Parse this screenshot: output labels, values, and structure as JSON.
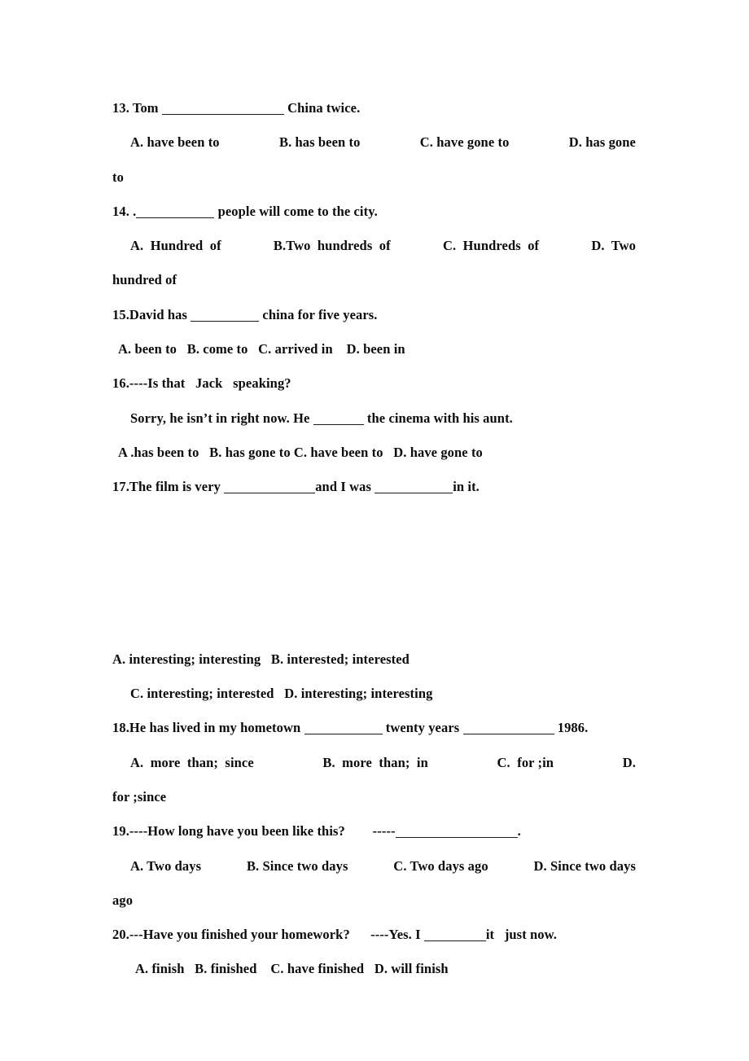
{
  "document": {
    "type": "english-grammar-multiple-choice-worksheet",
    "page_background": "#ffffff",
    "text_color": "#0b0b0b"
  },
  "questions": [
    {
      "number": "13.",
      "stem_before": "13. Tom ",
      "stem_after": " China twice.",
      "options_line": {
        "a": "A. have been to",
        "b": "B. has been to",
        "c": "C. have gone to",
        "d": "D. has gone"
      },
      "wrap": "to"
    },
    {
      "number": "14.",
      "stem_before": "14. .",
      "stem_after": " people will come to the city.",
      "options_line": {
        "a": "A.  Hundred  of",
        "b": "B.Two  hundreds  of",
        "c": "C.  Hundreds  of",
        "d": "D.  Two"
      },
      "wrap": "hundred of"
    },
    {
      "number": "15.",
      "stem_before": "15.David has ",
      "stem_after": " china for five years.",
      "options_line_text": "A. been to   B. come to   C. arrived in    D. been in"
    },
    {
      "number": "16.",
      "stem_text": "16.----Is that   Jack   speaking?",
      "dialogue_before": "Sorry, he isn’t in right now. He ",
      "dialogue_after": " the cinema with his aunt.",
      "options_line_text": "A .has been to   B. has gone to C. have been to   D. have gone to"
    },
    {
      "number": "17.",
      "stem_part1": "17.The film is very ",
      "stem_part2": "and I was ",
      "stem_part3": "in it.",
      "options_line_1": "A. interesting; interesting   B. interested; interested",
      "options_line_2": "C. interesting; interested   D. interesting; interesting"
    },
    {
      "number": "18.",
      "stem_part1": "18.He has lived in my hometown ",
      "stem_part2": " twenty years ",
      "stem_part3": " 1986.",
      "options_line": {
        "a": "A.  more  than;  since",
        "b": "B.  more  than;  in",
        "c": "C.  for ;in",
        "d": "D."
      },
      "wrap": "for ;since"
    },
    {
      "number": "19.",
      "stem_before": "19.----How long have you been like this?        -----",
      "stem_after": ".",
      "options_line": {
        "a": "A. Two days",
        "b": "B. Since two days",
        "c": "C. Two days ago",
        "d": "D. Since two days"
      },
      "wrap": "ago"
    },
    {
      "number": "20.",
      "stem_before": "20.---Have you finished your homework?      ----Yes. I ",
      "stem_after": "it   just now.",
      "options_line_text": "A. finish   B. finished    C. have finished   D. will finish"
    }
  ]
}
